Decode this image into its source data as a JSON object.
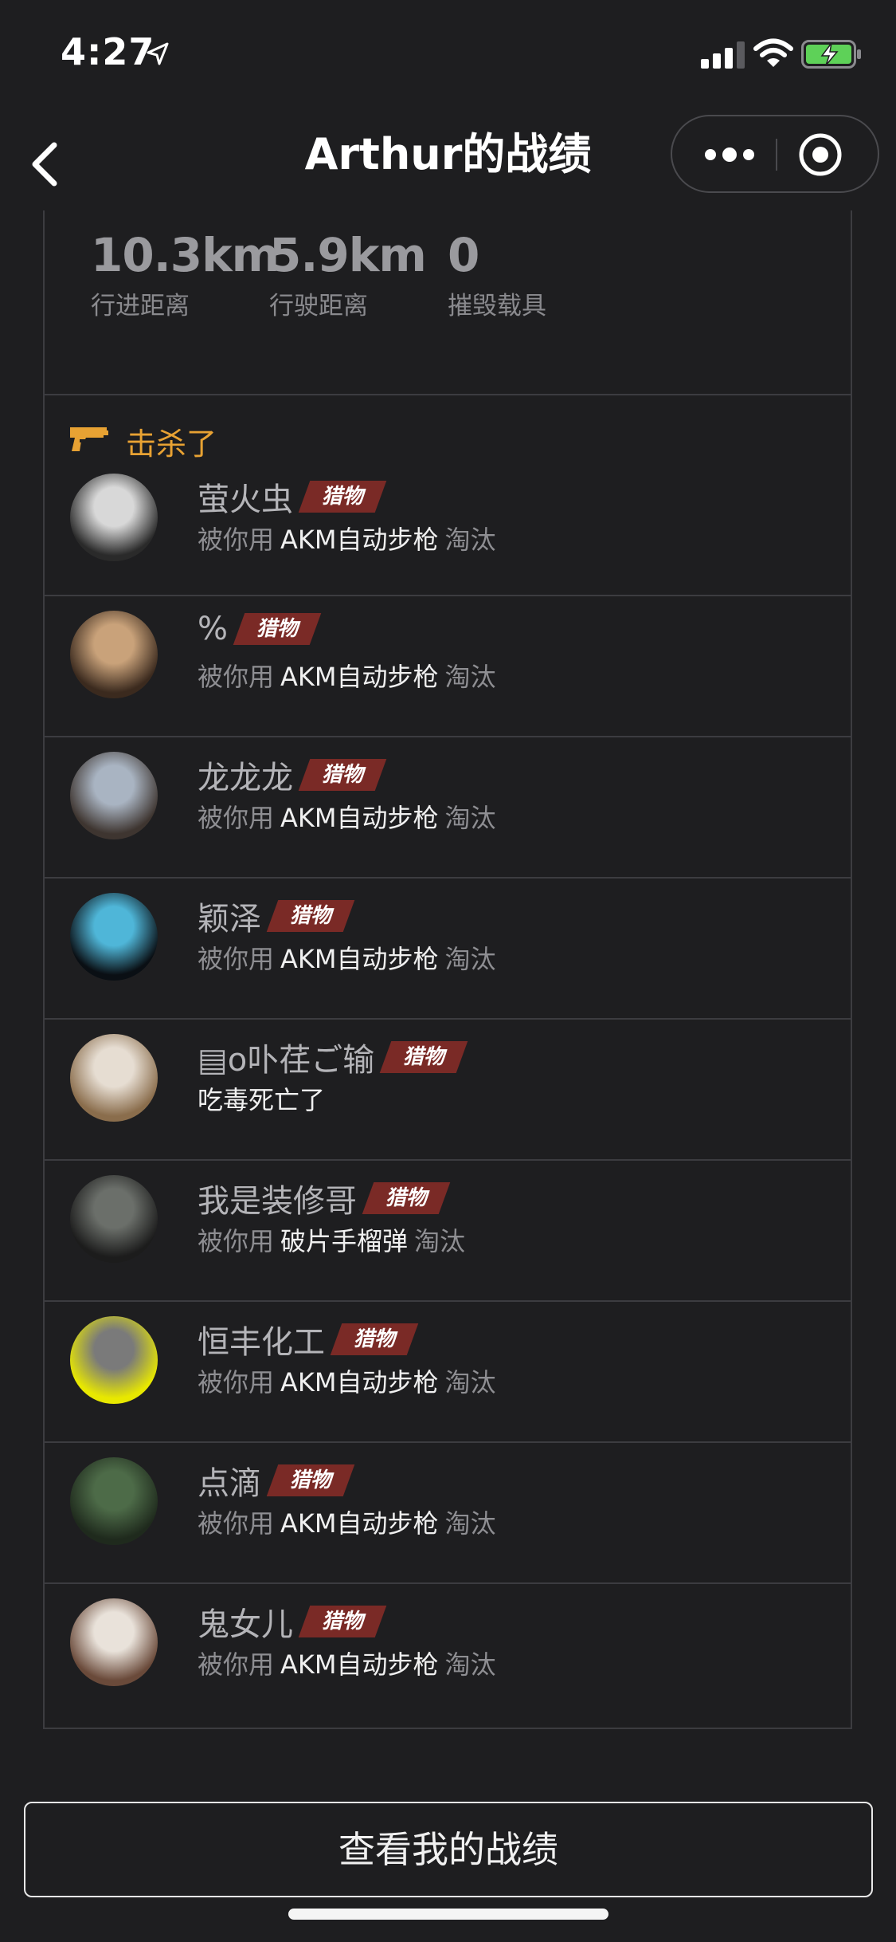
{
  "status_bar": {
    "time": "4:27"
  },
  "nav": {
    "title": "Arthur的战绩"
  },
  "stats": [
    {
      "value": "10.3km",
      "label": "行进距离"
    },
    {
      "value": "5.9km",
      "label": "行驶距离"
    },
    {
      "value": "0",
      "label": "摧毁载具"
    }
  ],
  "kills_section": {
    "title": "击杀了"
  },
  "kills": [
    {
      "name": "萤火虫",
      "tag": "猎物",
      "prefix": "被你用",
      "weapon": "AKM自动步枪",
      "suffix": "淘汰",
      "avatar_colors": [
        "#d8d8d8",
        "#2a2a2a"
      ]
    },
    {
      "name": "%",
      "tag": "猎物",
      "prefix": "被你用",
      "weapon": "AKM自动步枪",
      "suffix": "淘汰",
      "avatar_colors": [
        "#c9a27a",
        "#3b2a1e"
      ]
    },
    {
      "name": "龙龙龙",
      "tag": "猎物",
      "prefix": "被你用",
      "weapon": "AKM自动步枪",
      "suffix": "淘汰",
      "avatar_colors": [
        "#a9b4c2",
        "#3e3530"
      ]
    },
    {
      "name": "颖泽",
      "tag": "猎物",
      "prefix": "被你用",
      "weapon": "AKM自动步枪",
      "suffix": "淘汰",
      "avatar_colors": [
        "#4fb6d8",
        "#0a0f14"
      ]
    },
    {
      "name": "▤o卟荏ご输",
      "tag": "猎物",
      "plain": "吃毒死亡了",
      "avatar_colors": [
        "#e6ddd2",
        "#8a6d4c"
      ]
    },
    {
      "name": "我是装修哥",
      "tag": "猎物",
      "prefix": "被你用",
      "weapon": "破片手榴弹",
      "suffix": "淘汰",
      "avatar_colors": [
        "#6b6f6a",
        "#1c1c1c"
      ]
    },
    {
      "name": "恒丰化工",
      "tag": "猎物",
      "prefix": "被你用",
      "weapon": "AKM自动步枪",
      "suffix": "淘汰",
      "avatar_colors": [
        "#7a7a7a",
        "#e8e800"
      ]
    },
    {
      "name": "点滴",
      "tag": "猎物",
      "prefix": "被你用",
      "weapon": "AKM自动步枪",
      "suffix": "淘汰",
      "avatar_colors": [
        "#4d6b48",
        "#1f2a1d"
      ]
    },
    {
      "name": "鬼女儿",
      "tag": "猎物",
      "prefix": "被你用",
      "weapon": "AKM自动步枪",
      "suffix": "淘汰",
      "avatar_colors": [
        "#e9e2da",
        "#6a4a3a"
      ]
    }
  ],
  "footer": {
    "button_label": "查看我的战绩"
  }
}
